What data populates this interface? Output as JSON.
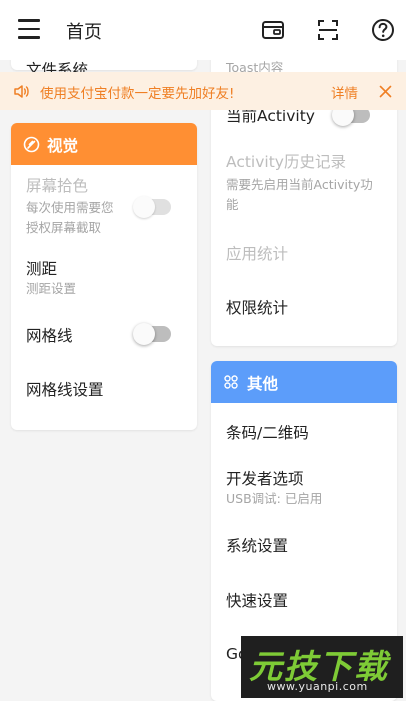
{
  "appbar": {
    "title": "首页",
    "icons": [
      "menu-icon",
      "wallet-icon",
      "scan-icon",
      "help-icon"
    ]
  },
  "banner": {
    "text": "使用支付宝付款一定要先加好友!",
    "detail": "详情",
    "color": "#ef7f24"
  },
  "left": {
    "top_partial": "文件系统",
    "section": {
      "title": "视觉",
      "color": "#ff8f33"
    },
    "items": [
      {
        "title": "屏幕拾色",
        "subtitle_lines": [
          "每次使用需要您",
          "授权屏幕截取"
        ],
        "toggle": false,
        "enabled": false
      },
      {
        "title": "测距",
        "subtitle": "测距设置"
      },
      {
        "title": "网格线",
        "toggle": false
      },
      {
        "title": "网格线设置"
      }
    ]
  },
  "right": {
    "top_partial": "Toast内容",
    "items_top": [
      {
        "title": "当前Activity",
        "toggle": false,
        "enabled": true
      },
      {
        "title": "Activity历史记录",
        "subtitle_lines": [
          "需要先启用当前Activity功",
          "能"
        ],
        "enabled": false
      },
      {
        "title": "应用统计",
        "enabled": false
      },
      {
        "title": "权限统计",
        "enabled": true
      }
    ],
    "section": {
      "title": "其他",
      "color": "#5c9dfa"
    },
    "items": [
      {
        "title": "条码/二维码"
      },
      {
        "title": "开发者选项",
        "subtitle": "USB调试: 已启用"
      },
      {
        "title": "系统设置"
      },
      {
        "title": "快速设置"
      },
      {
        "title": "Goo"
      }
    ]
  },
  "watermark": {
    "big": "元技下载",
    "small": "www.yuanpi.com"
  }
}
